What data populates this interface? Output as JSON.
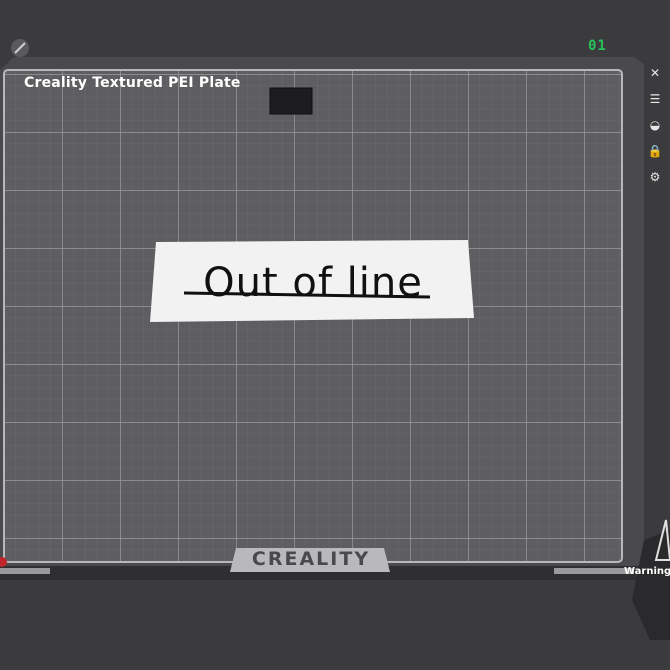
{
  "plate": {
    "title": "Creality Textured PEI Plate",
    "number": "01",
    "brand_logo_text": "CREALITY"
  },
  "model": {
    "text": "Out of line"
  },
  "toolbar": {
    "icons": [
      "close-icon",
      "list-icon",
      "orient-icon",
      "lock-icon",
      "settings-icon"
    ]
  },
  "status": {
    "warning_text": "Warning"
  },
  "colors": {
    "background": "#3b3b3d",
    "plate_grid": "#8a8a8c",
    "plate_number": "#27c25a",
    "model_face": "#f2f2f2",
    "model_text": "#111111",
    "warning_marker": "#c0262b"
  }
}
